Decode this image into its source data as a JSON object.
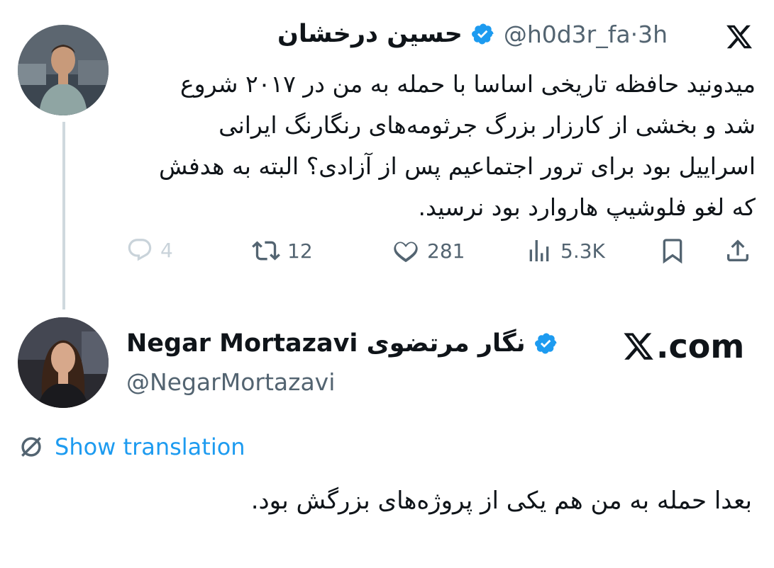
{
  "tweet1": {
    "display_name": "حسین درخشان",
    "handle_time": "@h0d3r_fa·3h",
    "text": "میدونید حافظه تاریخی اساسا با حمله به من در ۲۰۱۷ شروع شد و بخشی از کارزار بزرگ جرثومه‌های رنگارنگ ایرانی اسراییل بود برای ترور اجتماعیم پس از آزادی؟ البته به هدفش که لغو فلوشیپ هاروارد بود نرسید.",
    "actions": {
      "replies": "4",
      "retweets": "12",
      "likes": "281",
      "views": "5.3K"
    },
    "icons": {
      "logo": "x-logo-icon",
      "verified": "verified-badge-icon",
      "reply": "reply-icon",
      "retweet": "retweet-icon",
      "like": "heart-icon",
      "views": "views-icon",
      "bookmark": "bookmark-icon",
      "share": "share-icon"
    }
  },
  "tweet2": {
    "display_name": "Negar Mortazavi نگار مرتضوی",
    "handle": "@NegarMortazavi",
    "translate_label": "Show translation",
    "text": "بعدا حمله به من هم یکی از پروژه‌های بزرگش بود.",
    "icons": {
      "verified": "verified-badge-icon",
      "translate": "translate-icon"
    }
  },
  "watermark": {
    "text": ".com",
    "logo": "x-logo-icon"
  },
  "colors": {
    "accent": "#1d9bf0",
    "text": "#0f1419",
    "muted": "#536471",
    "thread_line": "#cfd9de",
    "reply_faded": "#c9d3da"
  }
}
